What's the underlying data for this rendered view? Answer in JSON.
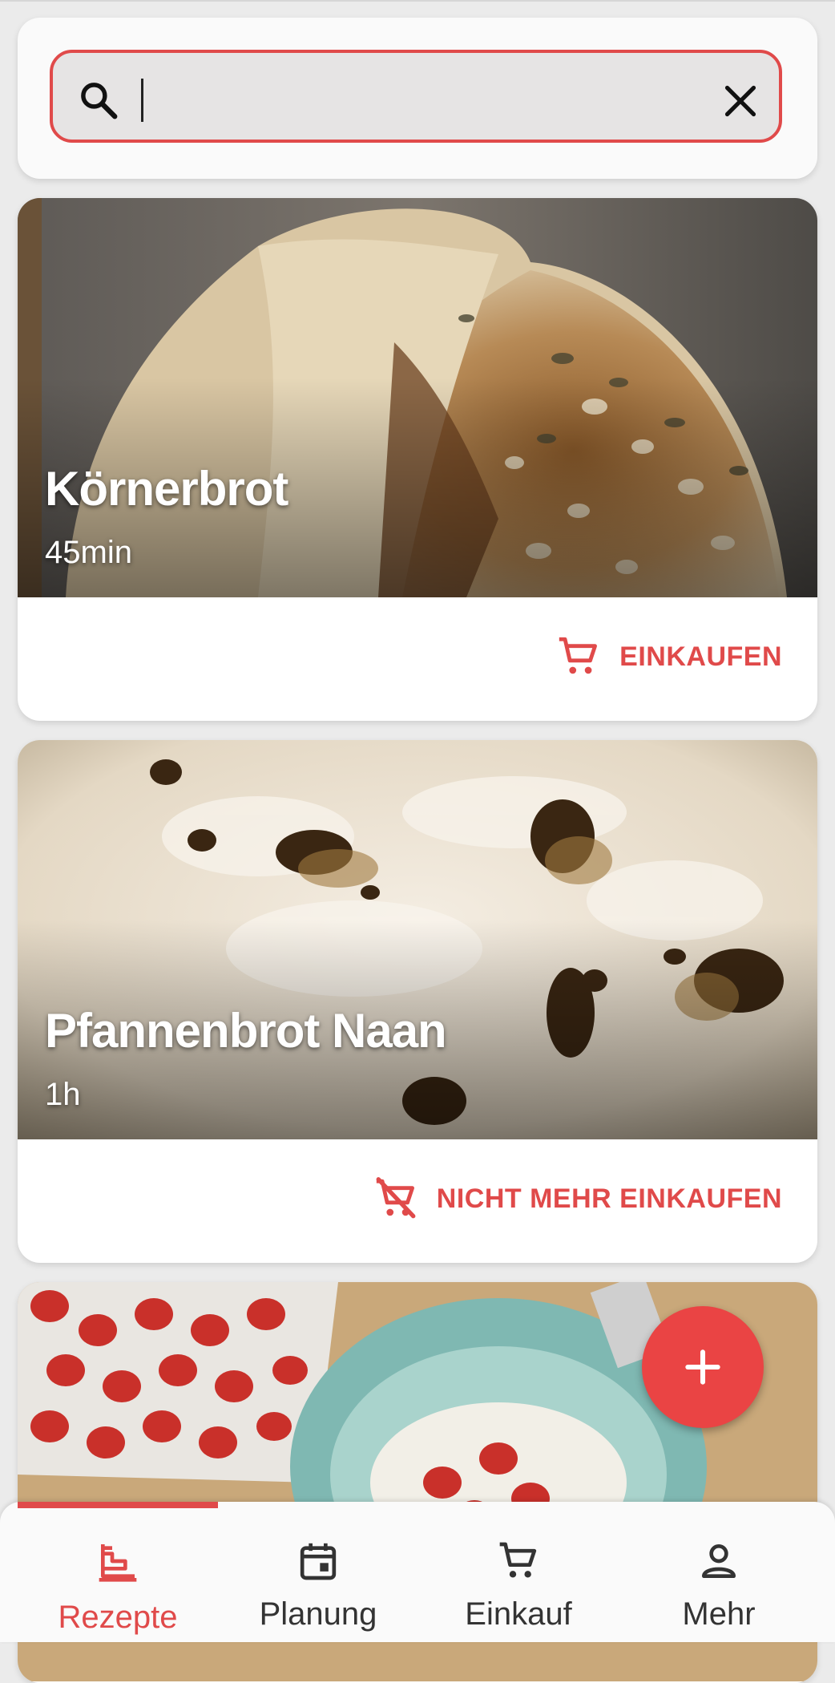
{
  "search": {
    "value": "",
    "placeholder": ""
  },
  "recipes": [
    {
      "title": "Körnerbrot",
      "time": "45min",
      "action_label": "EINKAUFEN",
      "action_icon": "cart-icon"
    },
    {
      "title": "Pfannenbrot Naan",
      "time": "1h",
      "action_label": "NICHT MEHR EINKAUFEN",
      "action_icon": "cart-off-icon"
    }
  ],
  "fab": {
    "icon": "plus-icon"
  },
  "nav": {
    "items": [
      {
        "label": "Rezepte",
        "icon": "recipe-icon",
        "active": true
      },
      {
        "label": "Planung",
        "icon": "calendar-icon",
        "active": false
      },
      {
        "label": "Einkauf",
        "icon": "cart-icon",
        "active": false
      },
      {
        "label": "Mehr",
        "icon": "person-icon",
        "active": false
      }
    ]
  },
  "colors": {
    "accent": "#e04a4a",
    "fab": "#ea4444",
    "background": "#ebebeb",
    "card": "#ffffff"
  }
}
